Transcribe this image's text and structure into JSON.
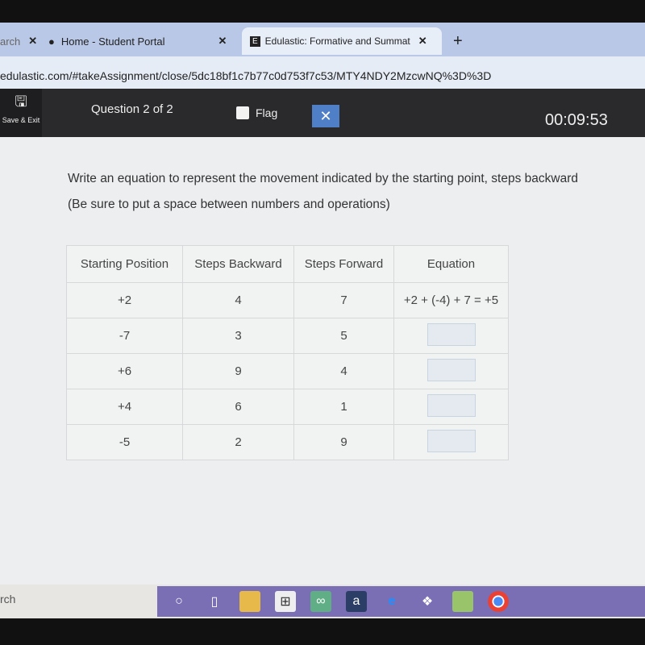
{
  "browser": {
    "tabs": [
      {
        "label": "arch",
        "close": "✕"
      },
      {
        "label": "Home - Student Portal",
        "close": "✕"
      },
      {
        "label": "Edulastic: Formative and Summat",
        "close": "✕",
        "active": true
      }
    ],
    "new_tab": "+",
    "url": "edulastic.com/#takeAssignment/close/5dc18bf1c7b77c0d753f7c53/MTY4NDY2MzcwNQ%3D%3D"
  },
  "toolbar": {
    "save_exit": "Save & Exit",
    "question": "Question 2 of 2",
    "flag_label": "Flag",
    "flag_checked": false,
    "close": "✕",
    "timer": "00:09:53",
    "accent": "#4f7fc6"
  },
  "question": {
    "line1": "Write an equation to represent the movement indicated by the starting point, steps backward",
    "line2": "(Be sure to put a space between numbers and operations)"
  },
  "table": {
    "headers": [
      "Starting Position",
      "Steps Backward",
      "Steps Forward",
      "Equation"
    ],
    "rows": [
      [
        "+2",
        "4",
        "7",
        "+2 + (-4) + 7 = +5"
      ],
      [
        "-7",
        "3",
        "5",
        ""
      ],
      [
        "+6",
        "9",
        "4",
        ""
      ],
      [
        "+4",
        "6",
        "1",
        ""
      ],
      [
        "-5",
        "2",
        "9",
        ""
      ]
    ]
  },
  "taskbar": {
    "search": "rch",
    "icons": [
      "cortana-icon",
      "task-view-icon",
      "file-explorer-icon",
      "store-icon",
      "tripadvisor-icon",
      "amazon-icon",
      "edge-icon",
      "dropbox-icon",
      "photos-icon",
      "chrome-icon"
    ],
    "color": "#7a6eb4"
  }
}
